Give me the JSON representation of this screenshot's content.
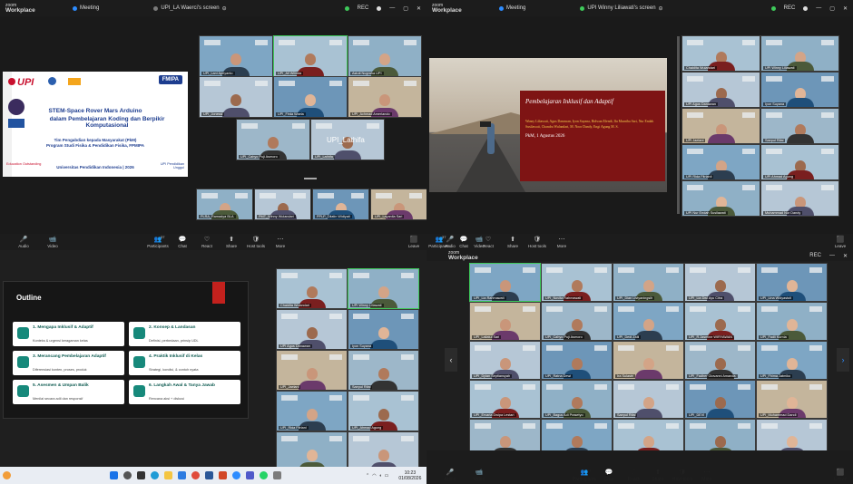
{
  "brand": {
    "line1": "zoom",
    "line2": "Workplace"
  },
  "meeting_label": "Meeting",
  "q1": {
    "share_tab": "UPI_LA Waerci's screen",
    "rec": "REC"
  },
  "q2": {
    "share_tab": "UPI Winny Liliawati's screen",
    "rec": "REC"
  },
  "controls": [
    "Audio",
    "Video",
    "Participants",
    "Chat",
    "React",
    "Share",
    "Host tools",
    "More",
    "Leave"
  ],
  "participant_count": "37",
  "slide1": {
    "upi": "UPI",
    "fmipa": "FMIPA",
    "title1": "STEM-Space Rover Mars Arduino",
    "title2": "dalam Pembelajaran Koding dan Berpikir Komputasional",
    "team1": "Tim Pengabdian kepada Masyarakat (PkM)",
    "team2": "Program Studi Fisika & Pendidikan Fisika, FPMIPA",
    "footer": "Universitas Pendidikan Indonesia | 2026",
    "left_tag": "Education Outstanding",
    "right_tag": "UPI Pendidikan Unggul"
  },
  "q1_tiles": [
    "UPI_Lani Apriyanto",
    "UPI_Ali Wilinda",
    "Astuti Nugraha UPI",
    "UPI_Jonessi",
    "UPI_Firda Waela",
    "UPI_Achmad Amerlando",
    "UPI_Cahyo Puji Asmoro",
    "UPI_Lathifa"
  ],
  "active_speaker": "UPI_Lathifa",
  "q1_strip": [
    "PLRA_Ramadya BLA",
    "PMT_Winny Wulandari",
    "PPLP_Dilatin Widiyati",
    "UPI_Layanila Sari"
  ],
  "slide2": {
    "title": "Pembelajaran Inklusif dan Adaptif",
    "authors": "Winny Liliawati, Agus Danawan, Iyon Suyana, Ridwan Efendi, Ifa Murniba Sari, Nur Endah Susilawati, Chandra Wulandari, M. Noor Dandy, Engi Agung M. S.",
    "date": "PkM, 1 Agustus 2026"
  },
  "q2_tiles": [
    "Chaidita Wulandari",
    "UPI Winny Liliawati",
    "UPI Agus Danawan",
    "Iyon Suyana",
    "UPI Jaelani",
    "Saepul Rifai",
    "UPI Rida Fitrianii",
    "UPI Ahmad Agung",
    "UPI Nur Endah Susilawati",
    "Muhammad Nur Dandy"
  ],
  "slide3": {
    "title": "Outline",
    "items": [
      {
        "t": "1. Mengapa Inklusif & Adaptif",
        "s": "Konteks & urgensi keragaman kelas"
      },
      {
        "t": "2. Konsep & Landasan",
        "s": "Definisi, perbedaan, prinsip UDL"
      },
      {
        "t": "3. Merancang Pembelajaran Adaptif",
        "s": "Diferensiasi konten, proses, produk"
      },
      {
        "t": "4. Praktik Inklusif di Kelas",
        "s": "Strategi, kondisi, & contoh nyata"
      },
      {
        "t": "5. Asesmen & Umpan Balik",
        "s": "Menilai secara adil dan responsif"
      },
      {
        "t": "6. Langkah Awal & Tanya Jawab",
        "s": "Rencana aksi + diskusi"
      }
    ]
  },
  "q3_tiles": [
    "Chaidita Wulandari",
    "UPI Winny Liliawati",
    "UPI Agus Danawan",
    "Iyon Suyana",
    "UPI_Jaelani",
    "Saepul Rifai",
    "UPI_Rida Fitriani",
    "UPI_Ahmad Agung",
    "UPI_Nur Endah Susilawati",
    "Muhammad Nur Dandy"
  ],
  "q4_tiles": [
    "UPI_Lia Rahmawati",
    "UPI_Novita Rahmawati",
    "UPI_Dian Listyaningsih",
    "UPI_Lia Dwi Ayu Citra",
    "UPI_Lina Widyastuti",
    "UPI_Lailatul Sari",
    "UPI_Cahyo Puji Asmoro",
    "UPI_Dedi Zalli",
    "UPI_R.Jasmine WIRYAWAN",
    "UPI_Fadli Kurnia",
    "UPI_Dylan Septiansyah",
    "UPI_Ratna Dewi",
    "Ira Sulastri",
    "UPI_Fadher Giovanni Amanda",
    "UPI_Fhima Jatmiko",
    "UPI_Ervaria Dwipa Lestari",
    "UPI_Bagus Adi Prasetyo",
    "Saepul Rifai",
    "UPI_DEVI",
    "UPI_Muhammad Dandi",
    "UPI_Riza Nuryadi",
    "UPI_Ani Rahmawati",
    "UPI_Adi Rochmat",
    "UPI_Ar Zahra",
    "UPI_Syarif Hidayah",
    "UPI_Nurul Aini",
    "Kananga Hamdan Faizah",
    "Dwi Lestari",
    "UPI_Rizky Hidayat",
    "UPI_Lathifa"
  ],
  "taskbar": {
    "time": "10:23",
    "date": "01/08/2026"
  }
}
